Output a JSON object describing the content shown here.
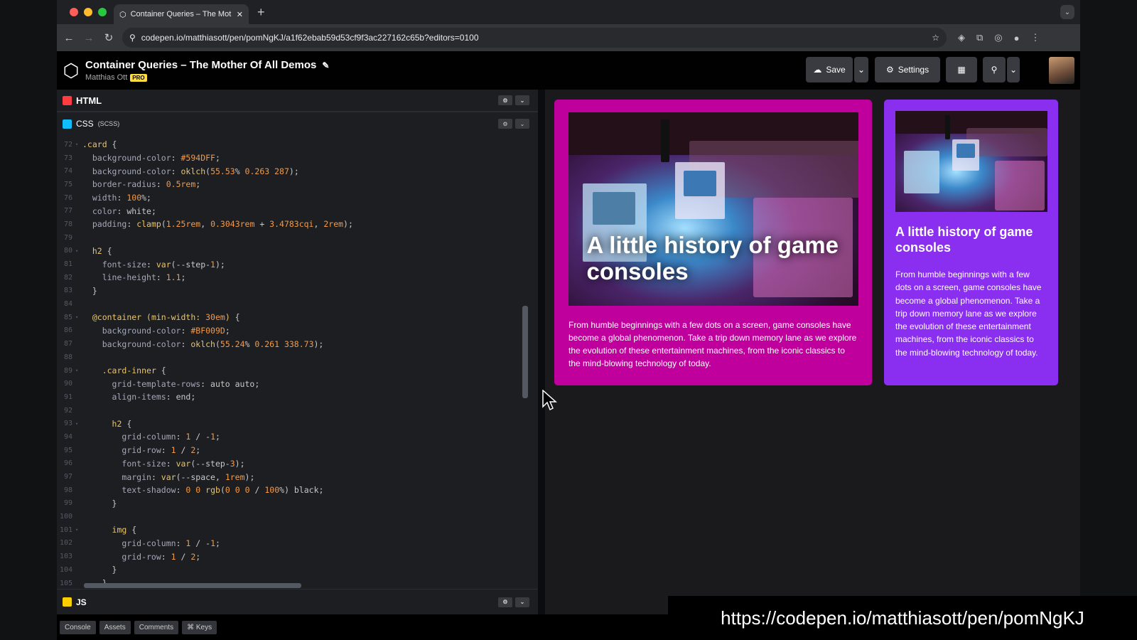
{
  "browser": {
    "tab_title": "Container Queries – The Mot",
    "url": "codepen.io/matthiasott/pen/pomNgKJ/a1f62ebab59d53cf9f3ac227162c65b?editors=0100"
  },
  "pen": {
    "title": "Container Queries – The Mother Of All Demos",
    "author": "Matthias Ott",
    "pro_badge": "PRO"
  },
  "header_buttons": {
    "save": "Save",
    "settings": "Settings"
  },
  "editor": {
    "html_label": "HTML",
    "css_label": "CSS",
    "css_sub": "(SCSS)",
    "js_label": "JS",
    "lines": [
      {
        "n": "72",
        "fold": true,
        "text": ".card {"
      },
      {
        "n": "73",
        "fold": false,
        "text": "  background-color: #594DFF;"
      },
      {
        "n": "74",
        "fold": false,
        "text": "  background-color: oklch(55.53% 0.263 287);"
      },
      {
        "n": "75",
        "fold": false,
        "text": "  border-radius: 0.5rem;"
      },
      {
        "n": "76",
        "fold": false,
        "text": "  width: 100%;"
      },
      {
        "n": "77",
        "fold": false,
        "text": "  color: white;"
      },
      {
        "n": "78",
        "fold": false,
        "text": "  padding: clamp(1.25rem, 0.3043rem + 3.4783cqi, 2rem);"
      },
      {
        "n": "79",
        "fold": false,
        "text": ""
      },
      {
        "n": "80",
        "fold": true,
        "text": "  h2 {"
      },
      {
        "n": "81",
        "fold": false,
        "text": "    font-size: var(--step-1);"
      },
      {
        "n": "82",
        "fold": false,
        "text": "    line-height: 1.1;"
      },
      {
        "n": "83",
        "fold": false,
        "text": "  }"
      },
      {
        "n": "84",
        "fold": false,
        "text": ""
      },
      {
        "n": "85",
        "fold": true,
        "text": "  @container (min-width: 30em) {"
      },
      {
        "n": "86",
        "fold": false,
        "text": "    background-color: #BF009D;"
      },
      {
        "n": "87",
        "fold": false,
        "text": "    background-color: oklch(55.24% 0.261 338.73);"
      },
      {
        "n": "88",
        "fold": false,
        "text": ""
      },
      {
        "n": "89",
        "fold": true,
        "text": "    .card-inner {"
      },
      {
        "n": "90",
        "fold": false,
        "text": "      grid-template-rows: auto auto;"
      },
      {
        "n": "91",
        "fold": false,
        "text": "      align-items: end;"
      },
      {
        "n": "92",
        "fold": false,
        "text": ""
      },
      {
        "n": "93",
        "fold": true,
        "text": "      h2 {"
      },
      {
        "n": "94",
        "fold": false,
        "text": "        grid-column: 1 / -1;"
      },
      {
        "n": "95",
        "fold": false,
        "text": "        grid-row: 1 / 2;"
      },
      {
        "n": "96",
        "fold": false,
        "text": "        font-size: var(--step-3);"
      },
      {
        "n": "97",
        "fold": false,
        "text": "        margin: var(--space, 1rem);"
      },
      {
        "n": "98",
        "fold": false,
        "text": "        text-shadow: 0 0 rgb(0 0 0 / 100%) black;"
      },
      {
        "n": "99",
        "fold": false,
        "text": "      }"
      },
      {
        "n": "100",
        "fold": false,
        "text": ""
      },
      {
        "n": "101",
        "fold": true,
        "text": "      img {"
      },
      {
        "n": "102",
        "fold": false,
        "text": "        grid-column: 1 / -1;"
      },
      {
        "n": "103",
        "fold": false,
        "text": "        grid-row: 1 / 2;"
      },
      {
        "n": "104",
        "fold": false,
        "text": "      }"
      },
      {
        "n": "105",
        "fold": false,
        "text": "    }"
      }
    ]
  },
  "footer_buttons": {
    "console": "Console",
    "assets": "Assets",
    "comments": "Comments",
    "keys": "⌘ Keys"
  },
  "preview": {
    "card_large": {
      "title": "A little history of game consoles",
      "body": "From humble beginnings with a few dots on a screen, game consoles have become a global phenomenon. Take a trip down memory lane as we explore the evolution of these entertainment machines, from the iconic classics to the mind-blowing technology of today."
    },
    "card_small": {
      "title": "A little history of game consoles",
      "body": "From humble beginnings with a few dots on a screen, game consoles have become a global phenomenon. Take a trip down memory lane as we explore the evolution of these entertainment machines, from the iconic classics to the mind-blowing technology of today."
    }
  },
  "overlay_url": "https://codepen.io/matthiasott/pen/pomNgKJ",
  "colors": {
    "card_large_bg": "#BF009D",
    "card_small_bg": "#8A2EF0",
    "pro_badge": "#FFDD40"
  }
}
